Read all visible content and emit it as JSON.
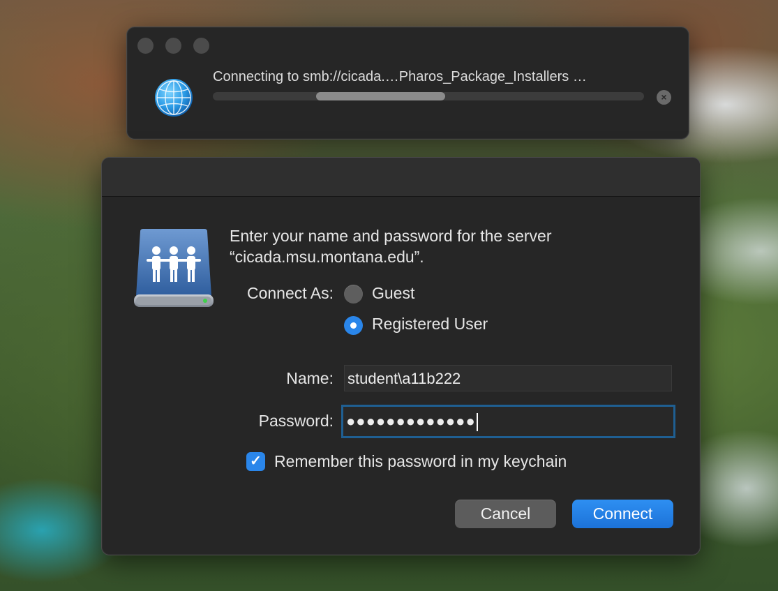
{
  "progress_window": {
    "connecting_text": "Connecting to smb://cicada.…Pharos_Package_Installers …",
    "progress_fraction": 0.3,
    "stop_icon": "×"
  },
  "auth_dialog": {
    "message_line1": "Enter your name and password for the server",
    "message_line2": "“cicada.msu.montana.edu”.",
    "connect_as_label": "Connect As:",
    "guest_label": "Guest",
    "registered_label": "Registered User",
    "selected_option": "Registered User",
    "name_label": "Name:",
    "name_value": "student\\a11b222",
    "password_label": "Password:",
    "password_value": "●●●●●●●●●●●●●",
    "remember_checked": true,
    "remember_label": "Remember this password in my keychain",
    "cancel_label": "Cancel",
    "connect_label": "Connect"
  },
  "colors": {
    "accent": "#2a86ea",
    "window_bg": "#262626"
  },
  "icons": {
    "network": "globe-icon",
    "server": "shared-server-drive-icon",
    "stop": "stop-icon",
    "check": "checkmark-icon"
  }
}
